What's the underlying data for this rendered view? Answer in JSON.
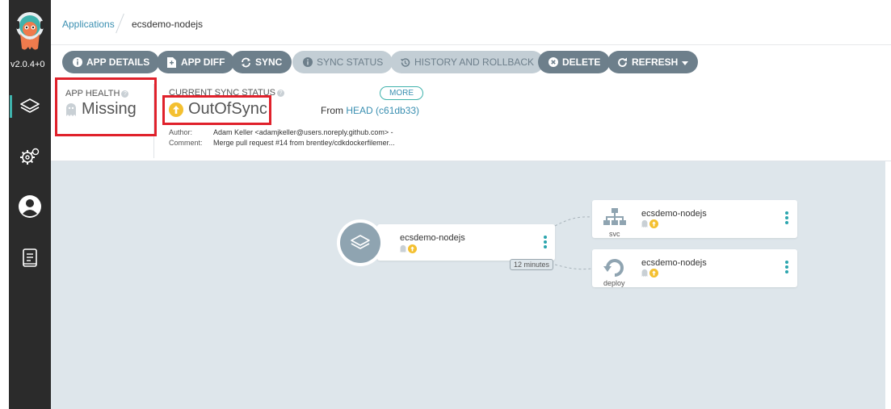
{
  "sidebar": {
    "version": "v2.0.4+0",
    "items": [
      {
        "icon": "layers-icon",
        "active": true
      },
      {
        "icon": "gears-icon",
        "active": false
      },
      {
        "icon": "user-icon",
        "active": false
      },
      {
        "icon": "docs-icon",
        "active": false
      }
    ]
  },
  "breadcrumb": {
    "root": "Applications",
    "current": "ecsdemo-nodejs"
  },
  "toolbar": {
    "app_details": "APP DETAILS",
    "app_diff": "APP DIFF",
    "sync": "SYNC",
    "sync_status": "SYNC STATUS",
    "history": "HISTORY AND ROLLBACK",
    "delete": "DELETE",
    "refresh": "REFRESH"
  },
  "status": {
    "health_label": "APP HEALTH",
    "health_value": "Missing",
    "sync_label": "CURRENT SYNC STATUS",
    "sync_value": "OutOfSync",
    "more": "MORE",
    "from_prefix": "From",
    "from_rev": "HEAD (c61db33)",
    "author_label": "Author:",
    "author_value": "Adam Keller <adamjkeller@users.noreply.github.com> -",
    "comment_label": "Comment:",
    "comment_value": "Merge pull request #14 from brentley/cdkdockerfilemer..."
  },
  "graph": {
    "app_node": {
      "name": "ecsdemo-nodejs",
      "age": "12 minutes"
    },
    "svc_node": {
      "name": "ecsdemo-nodejs",
      "kind": "svc"
    },
    "deploy_node": {
      "name": "ecsdemo-nodejs",
      "kind": "deploy"
    }
  },
  "colors": {
    "accent": "#3fb2ac",
    "link": "#3a8fb1",
    "button": "#6d7f8b",
    "outofsync": "#f4c030",
    "highlight": "#e0212b"
  }
}
